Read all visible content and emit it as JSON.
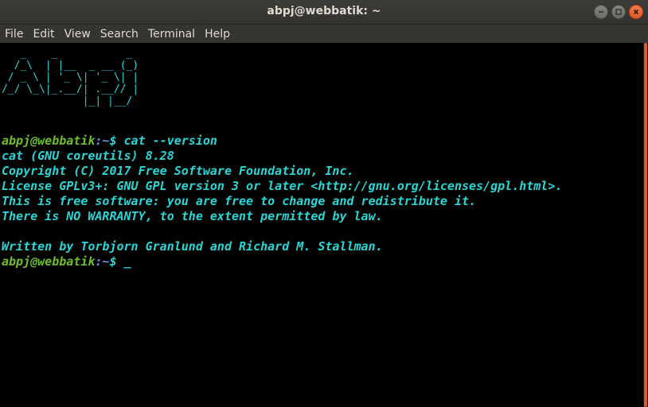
{
  "window": {
    "title": "abpj@webbatik: ~"
  },
  "menubar": {
    "items": [
      "File",
      "Edit",
      "View",
      "Search",
      "Terminal",
      "Help"
    ]
  },
  "terminal": {
    "banner": "   _    _           _ \n  /_\\  | |__  _ __ (_)\n / _ \\ | '_ \\| '_ \\| |\n/_/ \\_\\|_.__/| .__// |\n             |_| |__/ ",
    "prompt1": {
      "user": "abpj@webbatik",
      "path": ":~",
      "symbol": "$ ",
      "command": "cat --version"
    },
    "output": [
      "cat (GNU coreutils) 8.28",
      "Copyright (C) 2017 Free Software Foundation, Inc.",
      "License GPLv3+: GNU GPL version 3 or later <http://gnu.org/licenses/gpl.html>.",
      "This is free software: you are free to change and redistribute it.",
      "There is NO WARRANTY, to the extent permitted by law.",
      "",
      "Written by Torbjorn Granlund and Richard M. Stallman."
    ],
    "prompt2": {
      "user": "abpj@webbatik",
      "path": ":~",
      "symbol": "$ ",
      "cursor": "_"
    }
  },
  "colors": {
    "text": "#2ad6d6",
    "prompt_user": "#6fbf2c",
    "prompt_path": "#6f8ff0",
    "close_button": "#e2572a"
  },
  "icons": {
    "minimize": "minimize-icon",
    "maximize": "maximize-icon",
    "close": "close-icon"
  }
}
